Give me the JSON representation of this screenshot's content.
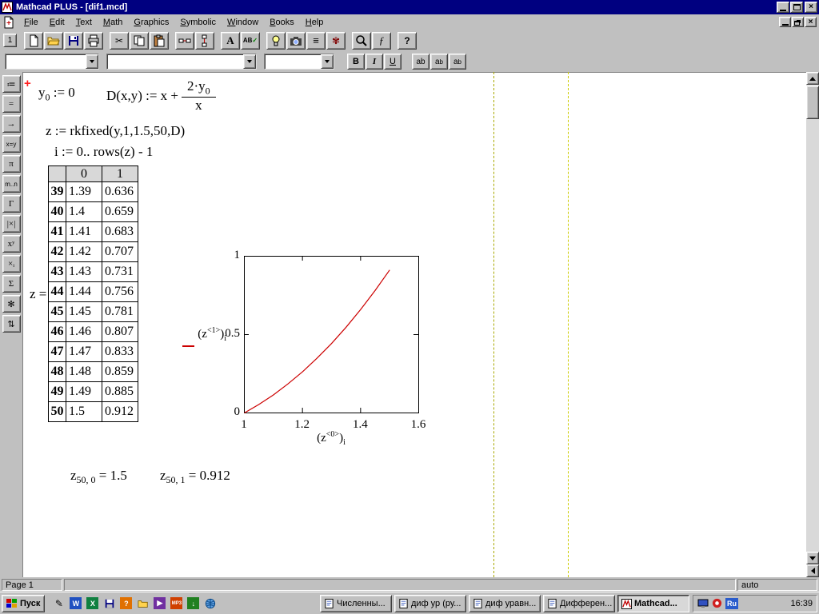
{
  "window": {
    "title": "Mathcad PLUS - [dif1.mcd]"
  },
  "menubar": {
    "items": [
      "File",
      "Edit",
      "Text",
      "Math",
      "Graphics",
      "Symbolic",
      "Window",
      "Books",
      "Help"
    ]
  },
  "toolbar": {
    "buttons": [
      {
        "name": "new-document"
      },
      {
        "name": "open-folder"
      },
      {
        "name": "save"
      },
      {
        "name": "print"
      },
      {
        "name": "cut"
      },
      {
        "name": "copy"
      },
      {
        "name": "paste"
      },
      {
        "name": "align-across"
      },
      {
        "name": "align-down"
      },
      {
        "name": "text-region"
      },
      {
        "name": "spell-check"
      },
      {
        "name": "quicksheets"
      },
      {
        "name": "camera"
      },
      {
        "name": "justify"
      },
      {
        "name": "symbolic-menu"
      },
      {
        "name": "zoom"
      },
      {
        "name": "insert-function"
      },
      {
        "name": "help"
      }
    ]
  },
  "format_bar": {
    "style_value": "",
    "font_value": "",
    "size_value": "",
    "bold": "B",
    "italic": "I",
    "underline": "U",
    "scripts": [
      {
        "mode": "normal",
        "text": "ab",
        "script": ""
      },
      {
        "mode": "sub",
        "text": "a",
        "script": "b"
      },
      {
        "mode": "sup",
        "text": "a",
        "script": "b"
      }
    ]
  },
  "palette": {
    "items": [
      {
        "name": "arithmetic",
        "glyph": "1",
        "small": false
      },
      {
        "name": "definition",
        "glyph": "≔",
        "small": false
      },
      {
        "name": "evaluation",
        "glyph": "=",
        "small": false
      },
      {
        "name": "symbolic-arrow",
        "glyph": "→",
        "small": false
      },
      {
        "name": "boolean",
        "glyph": "x=y",
        "small": true
      },
      {
        "name": "pi",
        "glyph": "π",
        "small": false
      },
      {
        "name": "range",
        "glyph": "m..n",
        "small": true
      },
      {
        "name": "gamma",
        "glyph": "Γ",
        "small": false
      },
      {
        "name": "absolute-value",
        "glyph": "|×|",
        "small": false
      },
      {
        "name": "power",
        "glyph": "xʸ",
        "small": false
      },
      {
        "name": "subscript",
        "glyph": "×ᵢ",
        "small": false
      },
      {
        "name": "summation",
        "glyph": "Σ",
        "small": false
      },
      {
        "name": "asterisk",
        "glyph": "✻",
        "small": false
      },
      {
        "name": "updown",
        "glyph": "⇅",
        "small": false
      }
    ]
  },
  "worksheet": {
    "cursor": "+",
    "regions": {
      "y0_def": {
        "base": "y",
        "sub": "0",
        "rhs": " := 0"
      },
      "d_def": {
        "lhs": "D(x,y) := x + ",
        "num": "2·y",
        "num_sub": "0",
        "den": "x"
      },
      "z_def": "z := rkfixed(y,1,1.5,50,D)",
      "i_def": "i := 0.. rows(z) - 1",
      "z_label": "z =",
      "result1": {
        "base": "z",
        "sub": "50, 0",
        "rhs": " = 1.5"
      },
      "result2": {
        "base": "z",
        "sub": "50, 1",
        "rhs": " = 0.912"
      }
    },
    "table": {
      "col_headers": [
        "0",
        "1"
      ],
      "row_indices": [
        39,
        40,
        41,
        42,
        43,
        44,
        45,
        46,
        47,
        48,
        49,
        50
      ],
      "col0": [
        "1.39",
        "1.4",
        "1.41",
        "1.42",
        "1.43",
        "1.44",
        "1.45",
        "1.46",
        "1.47",
        "1.48",
        "1.49",
        "1.5"
      ],
      "col1": [
        "0.636",
        "0.659",
        "0.683",
        "0.707",
        "0.731",
        "0.756",
        "0.781",
        "0.807",
        "0.833",
        "0.859",
        "0.885",
        "0.912"
      ]
    }
  },
  "chart_data": {
    "type": "line",
    "x": [
      1,
      1.05,
      1.1,
      1.15,
      1.2,
      1.25,
      1.3,
      1.35,
      1.4,
      1.45,
      1.5
    ],
    "y": [
      0,
      0.054,
      0.115,
      0.185,
      0.262,
      0.349,
      0.443,
      0.547,
      0.659,
      0.781,
      0.912
    ],
    "xlim": [
      1,
      1.6
    ],
    "ylim": [
      0,
      1
    ],
    "xticks": [
      {
        "value": 1,
        "label": "1"
      },
      {
        "value": 1.2,
        "label": "1.2"
      },
      {
        "value": 1.4,
        "label": "1.4"
      },
      {
        "value": 1.6,
        "label": "1.6"
      }
    ],
    "yticks": [
      {
        "value": 0,
        "label": "0"
      },
      {
        "value": 0.5,
        "label": "0.5"
      },
      {
        "value": 1,
        "label": "1"
      }
    ],
    "xlabel": {
      "open": "(z",
      "sup": "<0>",
      "close": ")",
      "sub": "i"
    },
    "ylabel": {
      "open": "(z",
      "sup": "<1>",
      "close": ")",
      "sub": "i"
    },
    "line_color": "#cc0000",
    "grid": false,
    "legend": "single red trace dash at left of y-axis label"
  },
  "status_bar": {
    "page": "Page 1",
    "auto": "auto"
  },
  "taskbar": {
    "start": "Пуск",
    "quick_launch": [
      {
        "name": "pen"
      },
      {
        "name": "word"
      },
      {
        "name": "excel"
      },
      {
        "name": "floppy"
      },
      {
        "name": "book"
      },
      {
        "name": "folder"
      },
      {
        "name": "media"
      },
      {
        "name": "mp3"
      },
      {
        "name": "download"
      },
      {
        "name": "globe"
      }
    ],
    "tasks": [
      {
        "label": "Численны...",
        "active": false,
        "icon": "doc"
      },
      {
        "label": "диф ур (ру...",
        "active": false,
        "icon": "doc"
      },
      {
        "label": "диф уравн...",
        "active": false,
        "icon": "doc"
      },
      {
        "label": "Дифферен...",
        "active": false,
        "icon": "doc"
      },
      {
        "label": "Mathcad...",
        "active": true,
        "icon": "mathcad"
      }
    ],
    "tray": {
      "icons": [
        {
          "name": "monitor"
        },
        {
          "name": "dialer"
        }
      ],
      "lang": "Ru",
      "clock": "16:39"
    }
  }
}
